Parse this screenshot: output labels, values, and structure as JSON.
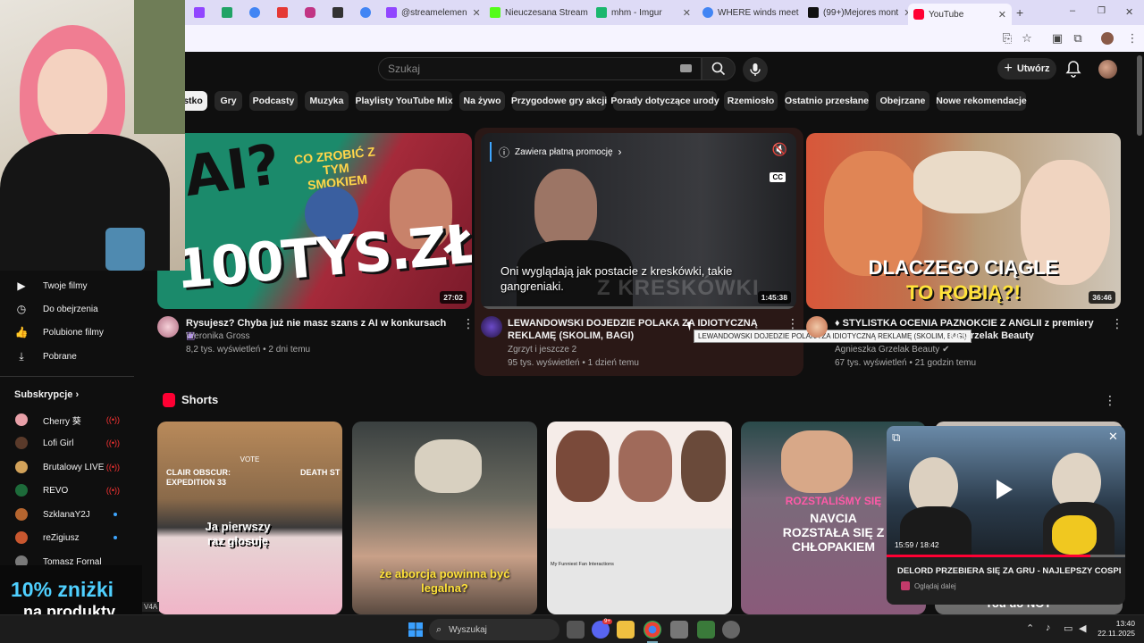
{
  "browser": {
    "tabs": [
      {
        "label": "",
        "color": "#9146ff"
      },
      {
        "label": "",
        "color": "#21a366"
      },
      {
        "label": "",
        "color": "#4285f4"
      },
      {
        "label": "",
        "color": "#e53935"
      },
      {
        "label": "",
        "color": "#c13584"
      },
      {
        "label": "",
        "color": "#333333"
      },
      {
        "label": "",
        "color": "#4285f4"
      },
      {
        "label": "@streamelemen",
        "color": "#9146ff"
      },
      {
        "label": "Nieuczesana Stream",
        "color": "#53fc18"
      },
      {
        "label": "mhm - Imgur",
        "color": "#1bb76e"
      },
      {
        "label": "WHERE winds meet",
        "color": "#4285f4"
      },
      {
        "label": "(99+)Mejores mont",
        "color": "#111111"
      },
      {
        "label": "YouTube",
        "color": "#ff0033"
      }
    ],
    "new_tab": "+",
    "win_min": "–",
    "win_max": "❐",
    "win_close": "✕"
  },
  "header": {
    "search_placeholder": "Szukaj",
    "create_label": "Utwórz"
  },
  "chips": [
    "stko",
    "Gry",
    "Podcasty",
    "Muzyka",
    "Playlisty YouTube Mix",
    "Na żywo",
    "Przygodowe gry akcji",
    "Porady dotyczące urody",
    "Rzemiosło",
    "Ostatnio przesłane",
    "Obejrzane",
    "Nowe rekomendacje"
  ],
  "videos": [
    {
      "title": "Rysujesz? Chyba już nie masz szans z AI w konkursach",
      "channel": "Weronika Gross",
      "meta": "8,2 tys. wyświetleń • 2 dni temu",
      "duration": "27:02",
      "thumb_top": "CO ZROBIĆ Z TYM SMOKIEM",
      "thumb_big": "100TYS.ZŁ",
      "thumb_left": "AI?"
    },
    {
      "title": "LEWANDOWSKI DOJEDZIE POLAKA ZA IDIOTYCZNĄ REKLAMĘ (SKOLIM, BAGI)",
      "channel": "Zgrzyt i jeszcze 2",
      "meta": "95 tys. wyświetleń • 1 dzień temu",
      "duration": "1:45:38",
      "promo": "Zawiera płatną promocję",
      "caption": "Oni wyglądają jak postacie z kreskówki, takie gangreniaki.",
      "watermark": "Z KRESKÓWKI",
      "cc": "CC",
      "tooltip": "LEWANDOWSKI DOJEDZIE POLAKA ZA IDIOTYCZNĄ REKLAMĘ (SKOLIM, BAGI)"
    },
    {
      "title": "♦ STYLISTKA OCENIA PAZNOKCIE Z ANGLII z premiery",
      "title2": "ka Grzelak Beauty",
      "channel": "Agnieszka Grzelak Beauty",
      "meta": "67 tys. wyświetleń • 21 godzin temu",
      "duration": "36:46",
      "thumb_line1": "DLACZEGO CIĄGLE",
      "thumb_line2": "TO ROBIĄ?!"
    }
  ],
  "sidebar": {
    "items": [
      {
        "label": "Twoje filmy",
        "icon": "▶"
      },
      {
        "label": "Do obejrzenia",
        "icon": "◷"
      },
      {
        "label": "Polubione filmy",
        "icon": "👍"
      },
      {
        "label": "Pobrane",
        "icon": "⤓"
      }
    ],
    "subs_title": "Subskrypcje",
    "subs": [
      {
        "name": "Cherry 葵",
        "status": "live",
        "color": "#e8a0a8"
      },
      {
        "name": "Lofi Girl",
        "status": "live",
        "color": "#5a3a2a"
      },
      {
        "name": "Brutalowy LIVE",
        "status": "live",
        "color": "#d2a25a"
      },
      {
        "name": "REVO",
        "status": "live",
        "color": "#1d6b3a"
      },
      {
        "name": "SzklanaY2J",
        "status": "dot",
        "color": "#b5652f"
      },
      {
        "name": "reZigiusz",
        "status": "dot",
        "color": "#c9572f"
      },
      {
        "name": "Tomasz Fornal",
        "status": "",
        "color": "#7a7a7a"
      }
    ]
  },
  "shorts": {
    "title": "Shorts",
    "items": [
      {
        "top": "VOTE",
        "left": "CLAIR OBSCUR: EXPEDITION 33",
        "right": "DEATH ST",
        "caption": "Ja pierwszy raz głosuję"
      },
      {
        "caption": "że aborcja powinna być legalna?"
      },
      {
        "caption": "My Funniest Fan Interactions"
      },
      {
        "line1": "ROZSTALIŚMY SIĘ",
        "line2": "NAVCIA",
        "line3": "ROZSTAŁA SIĘ Z",
        "line4": "CHŁOPAKIEM"
      },
      {
        "caption": "\"You do NOT"
      }
    ]
  },
  "miniplayer": {
    "time": "15:59 / 18:42",
    "title": "DELORD PRZEBIERA SIĘ ZA GRU - NAJLEPSZY COSPLAY...",
    "channel": "Oglądaj dalej",
    "progress": 0.854
  },
  "promo": {
    "line1": "10% zniżki",
    "line2": "na produkty",
    "code": "V4A"
  },
  "taskbar": {
    "search": "Wyszukaj",
    "time": "13:40",
    "date": "22.11.2025",
    "badge": "9+"
  }
}
